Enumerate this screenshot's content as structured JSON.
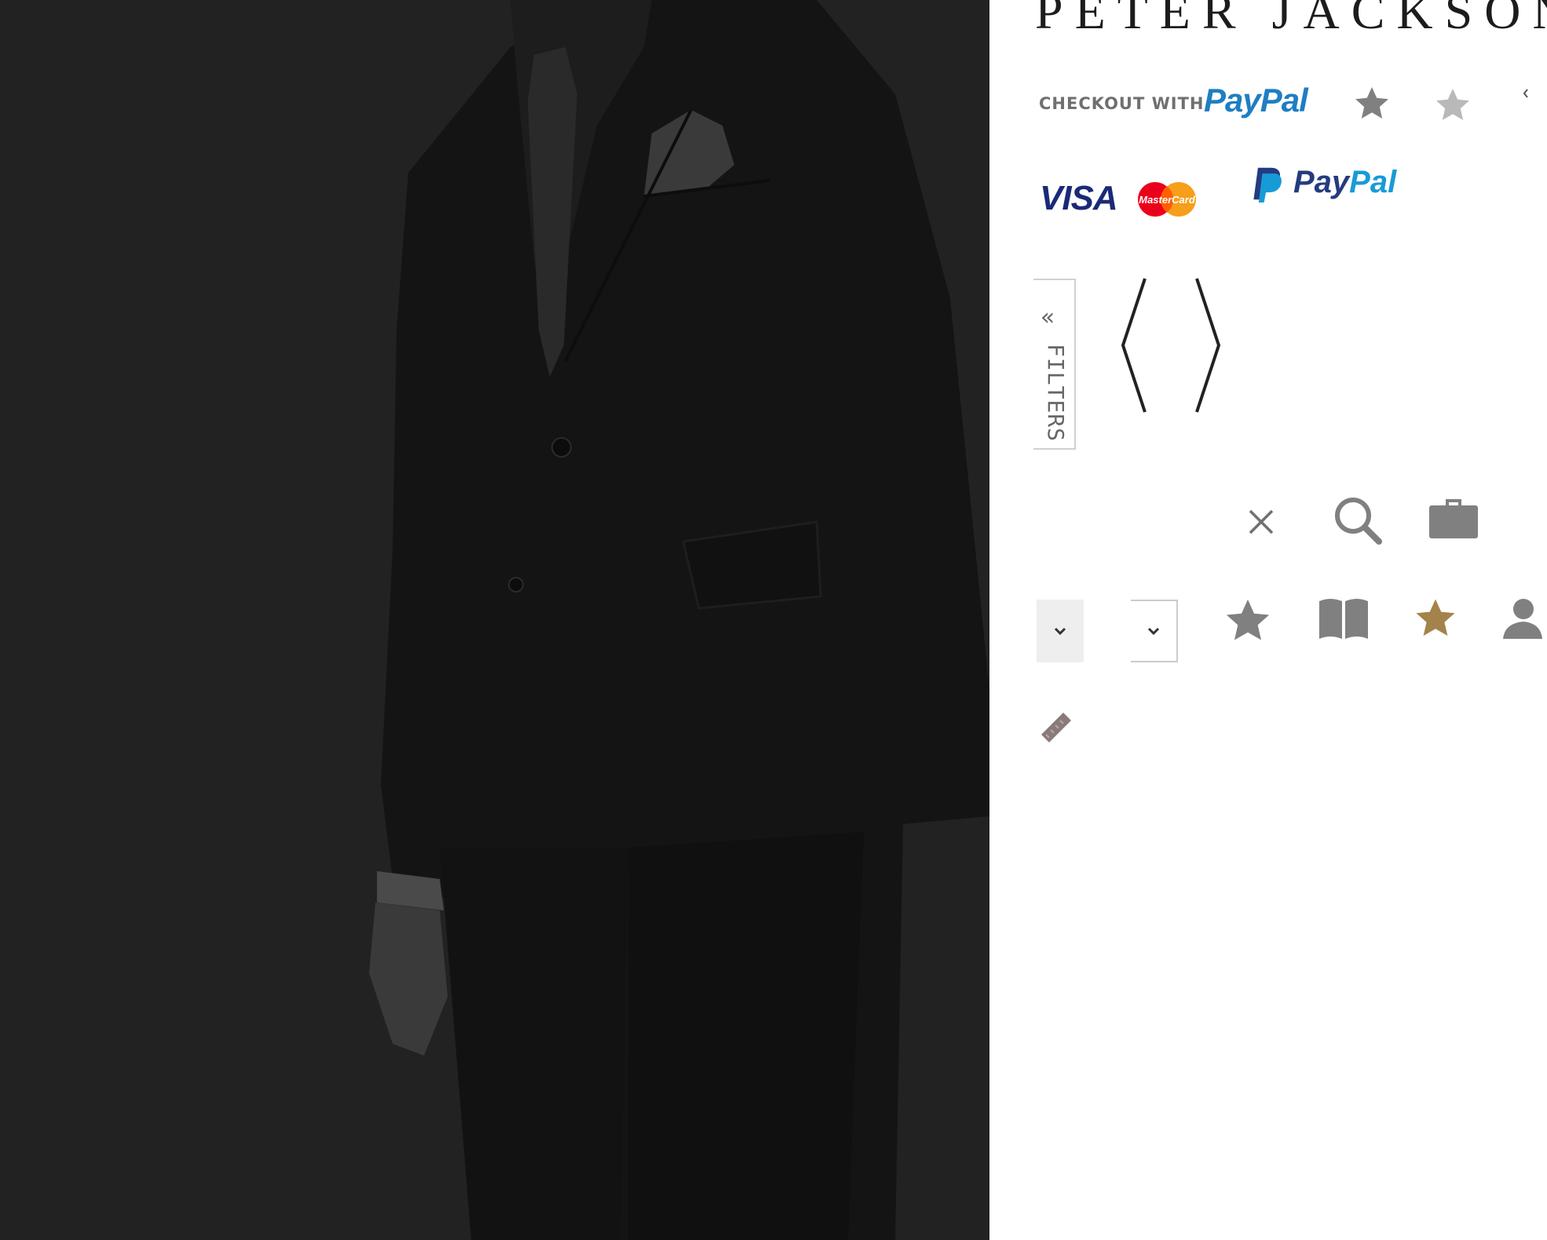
{
  "hero": {
    "image": "model-in-dark-suit-photo"
  },
  "sprite": {
    "logo_text": "PETER JACKSON",
    "checkout": {
      "label": "CHECKOUT WITH",
      "brand": "PayPal"
    },
    "payment": {
      "visa": "VISA",
      "mastercard": "MasterCard",
      "paypal_part1": "Pay",
      "paypal_part2": "Pal"
    },
    "filters": {
      "arrow": "«",
      "label": "FILTERS"
    },
    "icons": [
      "star-icon",
      "star-light-icon",
      "chevron-left-icon",
      "angle-left-icon",
      "angle-right-icon",
      "close-icon",
      "search-icon",
      "briefcase-icon",
      "chevron-down-icon",
      "book-icon",
      "gold-star-icon",
      "user-icon",
      "tape-icon"
    ],
    "colors": {
      "photo_overlay": "#222222",
      "paypal_dark": "#253b80",
      "paypal_light": "#179bd7",
      "visa_blue": "#1a2a78",
      "mastercard_red": "#eb001b",
      "mastercard_orange": "#f79e1b",
      "gold_star": "#a4834a",
      "icon_gray": "#808080"
    }
  }
}
